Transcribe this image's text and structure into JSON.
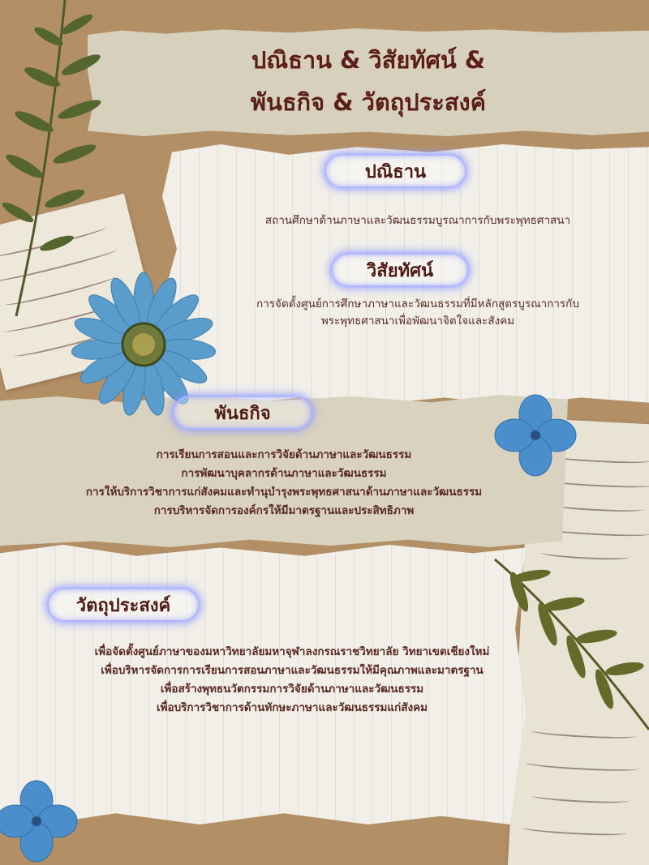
{
  "title": {
    "line1": "ปณิธาน & วิสัยทัศน์ &",
    "line2": "พันธกิจ & วัตถุประสงค์"
  },
  "pledge": {
    "heading": "ปณิธาน",
    "text": "สถานศึกษาด้านภาษาและวัฒนธรรมบูรณาการกับพระพุทธศาสนา"
  },
  "vision": {
    "heading": "วิสัยทัศน์",
    "lines": [
      "การจัดตั้งศูนย์การศึกษาภาษาและวัฒนธรรมที่มีหลักสูตรบูรณาการกับ",
      "พระพุทธศาสนาเพื่อพัฒนาจิตใจและสังคม"
    ]
  },
  "mission": {
    "heading": "พันธกิจ",
    "lines": [
      "การเรียนการสอนและการวิจัยด้านภาษาและวัฒนธรรม",
      "การพัฒนาบุคลากรด้านภาษาและวัฒนธรรม",
      "การให้บริการวิชาการแก่สังคมและทำนุบำรุงพระพุทธศาสนาด้านภาษาและวัฒนธรรม",
      "การบริหารจัดการองค์กรให้มีมาตรฐานและประสิทธิภาพ"
    ]
  },
  "objectives": {
    "heading": "วัตถุประสงค์",
    "lines": [
      "เพื่อจัดตั้งศูนย์ภาษาของมหาวิทยาลัยมหาจุฬาลงกรณราชวิทยาลัย วิทยาเขตเชียงใหม่",
      "เพื่อบริหารจัดการการเรียนการสอนภาษาและวัฒนธรรมให้มีคุณภาพและมาตรฐาน",
      "เพื่อสร้างพุทธนวัตกรรมการวิจัยด้านภาษาและวัฒนธรรม",
      "เพื่อบริการวิชาการด้านทักษะภาษาและวัฒนธรรมแก่สังคม"
    ]
  },
  "colors": {
    "background": "#b38f66",
    "heading_text": "#5b1e17",
    "glow": "#aeb6ff",
    "flower": "#4f8fc4"
  }
}
